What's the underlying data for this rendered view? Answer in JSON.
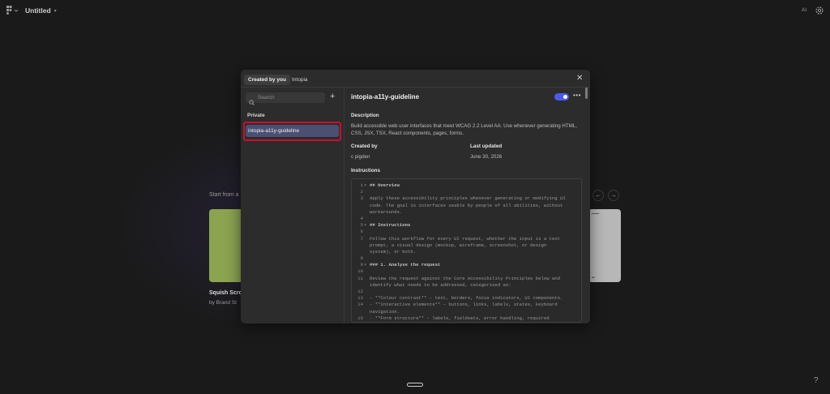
{
  "topbar": {
    "title": "Untitled",
    "ai_label": "AI"
  },
  "background": {
    "start_label": "Start from a",
    "card_name": "Squish Scro",
    "card_by": "by Brand St",
    "gray_card_dots": "••"
  },
  "modal": {
    "tabs": [
      {
        "label": "Created by you"
      },
      {
        "label": "Intopia"
      }
    ],
    "search_placeholder": "Search",
    "section_label": "Private",
    "selected_item": "intopia-a11y-guideline",
    "guideline": {
      "title": "intopia-a11y-guideline",
      "enabled": true,
      "description_label": "Description",
      "description": "Build accessible web user interfaces that meet WCAG 2.2 Level AA. Use whenever generating HTML, CSS, JSX, TSX, React components, pages, forms.",
      "created_by_label": "Created by",
      "created_by": "c pigden",
      "last_updated_label": "Last updated",
      "last_updated": "June 30, 2026",
      "instructions_label": "Instructions"
    },
    "code_lines": [
      {
        "n": "1",
        "fold": "▾",
        "text": "## Overview",
        "bold": true
      },
      {
        "n": "2",
        "fold": "",
        "text": "",
        "bold": false
      },
      {
        "n": "3",
        "fold": "",
        "text": "Apply these accessibility principles whenever generating or modifying UI",
        "bold": false
      },
      {
        "n": "",
        "fold": "",
        "text": "code. The goal is interfaces usable by people of all abilities, without",
        "bold": false
      },
      {
        "n": "",
        "fold": "",
        "text": "workarounds.",
        "bold": false
      },
      {
        "n": "4",
        "fold": "",
        "text": "",
        "bold": false
      },
      {
        "n": "5",
        "fold": "▾",
        "text": "## Instructions",
        "bold": true
      },
      {
        "n": "6",
        "fold": "",
        "text": "",
        "bold": false
      },
      {
        "n": "7",
        "fold": "",
        "text": "Follow this workflow for every UI request, whether the input is a text",
        "bold": false
      },
      {
        "n": "",
        "fold": "",
        "text": "prompt, a visual design (mockup, wireframe, screenshot, or design",
        "bold": false
      },
      {
        "n": "",
        "fold": "",
        "text": "system), or both.",
        "bold": false
      },
      {
        "n": "8",
        "fold": "",
        "text": "",
        "bold": false
      },
      {
        "n": "9",
        "fold": "▾",
        "text": "### 1. Analyse the request",
        "bold": true
      },
      {
        "n": "10",
        "fold": "",
        "text": "",
        "bold": false
      },
      {
        "n": "11",
        "fold": "",
        "text": "Review the request against the Core Accessibility Principles below and",
        "bold": false
      },
      {
        "n": "",
        "fold": "",
        "text": "identify what needs to be addressed, categorised as:",
        "bold": false
      },
      {
        "n": "12",
        "fold": "",
        "text": "",
        "bold": false
      },
      {
        "n": "13",
        "fold": "",
        "text": "- **Colour contrast** – text, borders, focus indicators, UI components.",
        "bold": false
      },
      {
        "n": "14",
        "fold": "",
        "text": "- **Interactive elements** – buttons, links, labels, states, keyboard",
        "bold": false
      },
      {
        "n": "",
        "fold": "",
        "text": "navigation.",
        "bold": false
      },
      {
        "n": "15",
        "fold": "",
        "text": "- **Form structure** – labels, fieldsets, error handling, required",
        "bold": false
      },
      {
        "n": "",
        "fold": "",
        "text": "fields.",
        "bold": false
      }
    ]
  },
  "colors": {
    "accent": "#4a5bea",
    "selected_item_bg": "#4b4f72",
    "highlight_border": "#c8102e",
    "green_card": "#8ca450"
  }
}
